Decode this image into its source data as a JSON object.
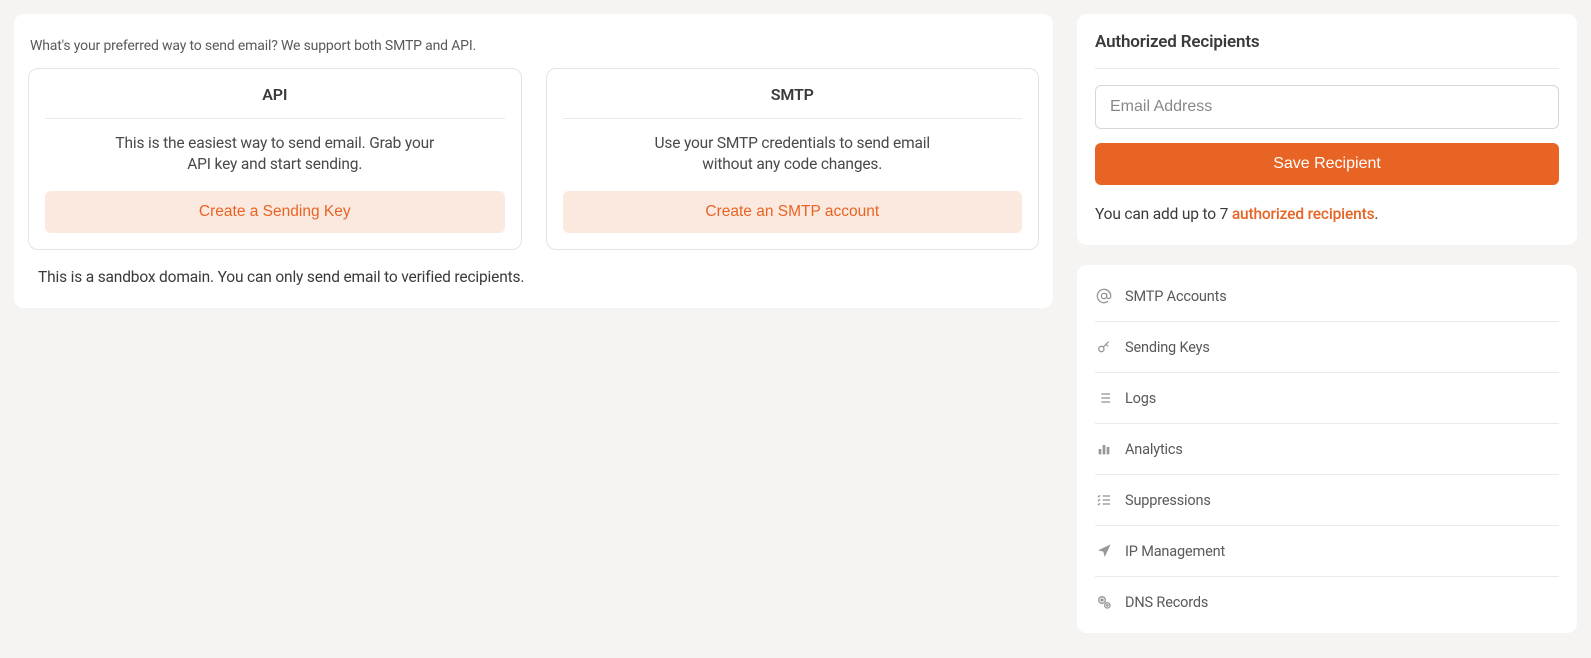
{
  "main": {
    "intro": "What's your preferred way to send email? We support both SMTP and API.",
    "cards": {
      "api": {
        "title": "API",
        "desc": "This is the easiest way to send email. Grab your API key and start sending.",
        "button": "Create a Sending Key"
      },
      "smtp": {
        "title": "SMTP",
        "desc": "Use your SMTP credentials to send email without any code changes.",
        "button": "Create an SMTP account"
      }
    },
    "footer": "This is a sandbox domain. You can only send email to verified recipients."
  },
  "recipients": {
    "title": "Authorized Recipients",
    "placeholder": "Email Address",
    "save": "Save Recipient",
    "limit_prefix": "You can add up to 7 ",
    "limit_link": "authorized recipients",
    "limit_suffix": "."
  },
  "nav": {
    "items": [
      {
        "label": "SMTP Accounts"
      },
      {
        "label": "Sending Keys"
      },
      {
        "label": "Logs"
      },
      {
        "label": "Analytics"
      },
      {
        "label": "Suppressions"
      },
      {
        "label": "IP Management"
      },
      {
        "label": "DNS Records"
      }
    ]
  }
}
